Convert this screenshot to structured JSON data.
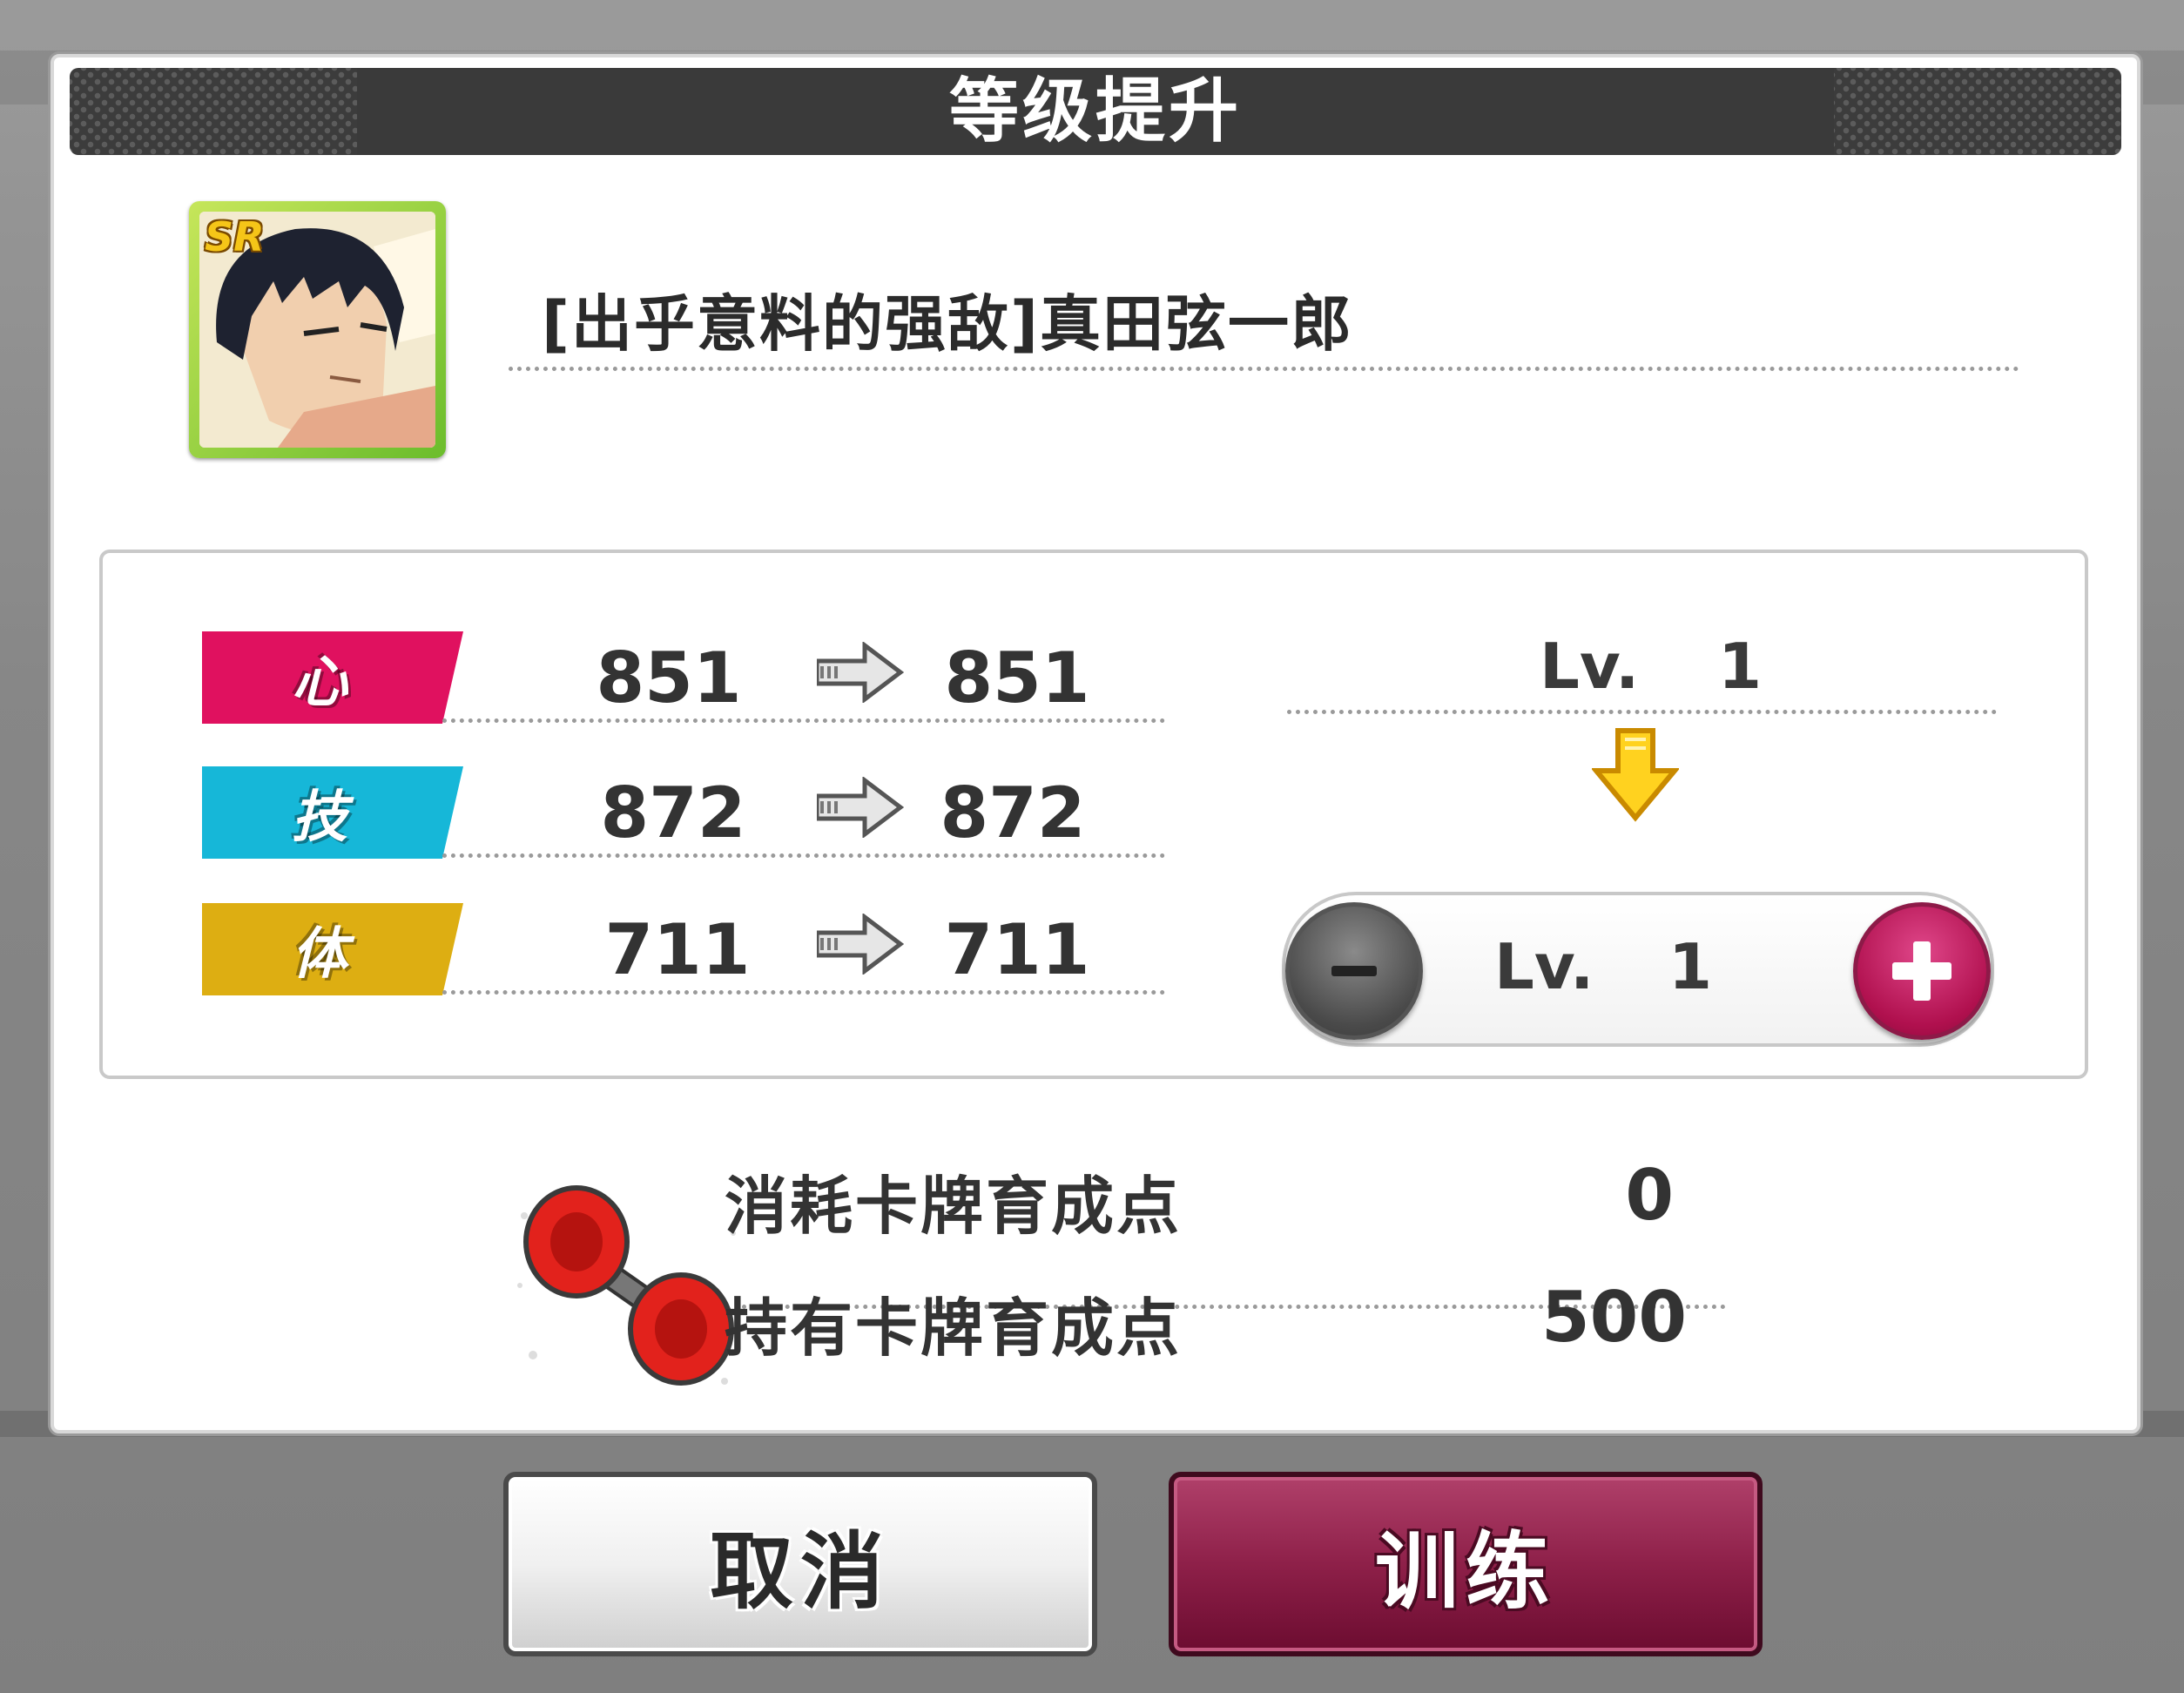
{
  "dialog": {
    "title": "等级提升"
  },
  "card": {
    "rarity": "SR",
    "name": "[出乎意料的强敌]真田弦一郎",
    "frame_color": "#7cc43a"
  },
  "stats": [
    {
      "label": "心",
      "color": "#e0115f",
      "before": "851",
      "after": "851"
    },
    {
      "label": "技",
      "color": "#16b7d8",
      "before": "872",
      "after": "872"
    },
    {
      "label": "体",
      "color": "#ddae12",
      "before": "711",
      "after": "711"
    }
  ],
  "level": {
    "prefix": "Lv.",
    "current": "1",
    "target": "1",
    "minus_icon": "minus-icon",
    "plus_icon": "plus-icon"
  },
  "points": {
    "consume_label": "消耗卡牌育成点",
    "consume_value": "0",
    "owned_label": "持有卡牌育成点",
    "owned_value": "500",
    "icon": "dumbbell-icon"
  },
  "buttons": {
    "cancel": "取消",
    "train": "训练"
  },
  "colors": {
    "accent": "#8e2049",
    "header": "#3c3c3c"
  }
}
